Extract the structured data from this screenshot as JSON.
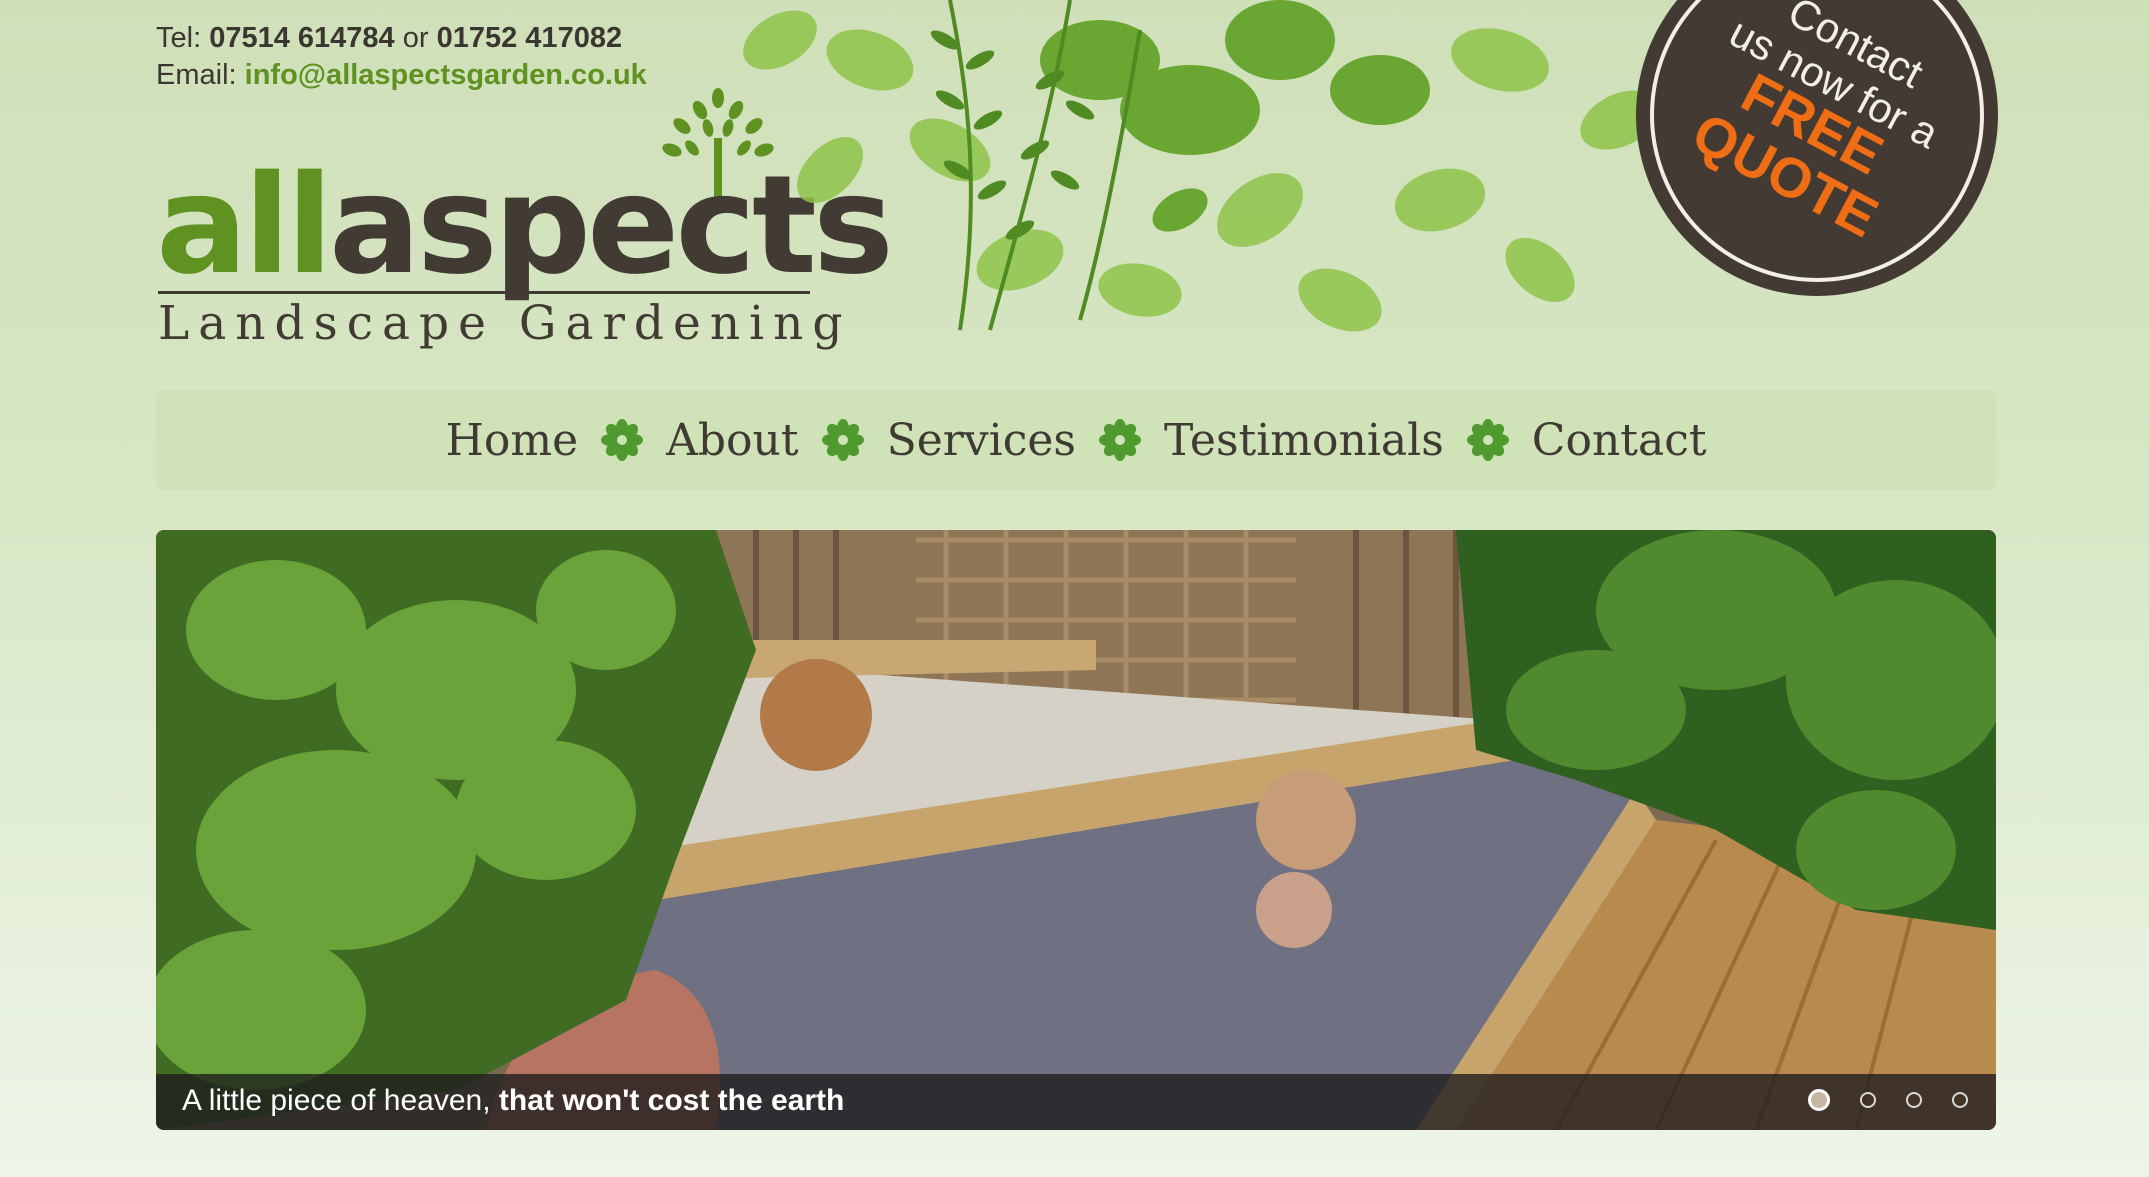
{
  "header": {
    "tel_label": "Tel:",
    "tel_1": "07514 614784",
    "tel_or": "or",
    "tel_2": "01752 417082",
    "email_label": "Email:",
    "email": "info@allaspectsgarden.co.uk"
  },
  "logo": {
    "word_all": "all",
    "word_aspects": "aspects",
    "tagline": "Landscape Gardening"
  },
  "quote_badge": {
    "line1": "Contact",
    "line2": "us now for a",
    "line3": "FREE",
    "line4": "QUOTE"
  },
  "nav": {
    "items": [
      {
        "label": "Home"
      },
      {
        "label": "About"
      },
      {
        "label": "Services"
      },
      {
        "label": "Testimonials"
      },
      {
        "label": "Contact"
      }
    ]
  },
  "hero": {
    "caption_normal": "A little piece of heaven,",
    "caption_bold": "that won't cost the earth",
    "slides": 4,
    "active_slide": 1
  },
  "colors": {
    "brand_green": "#5f9220",
    "brand_dark": "#413b33",
    "accent_orange": "#ef6e15",
    "nav_bg": "#d0e2b8"
  }
}
